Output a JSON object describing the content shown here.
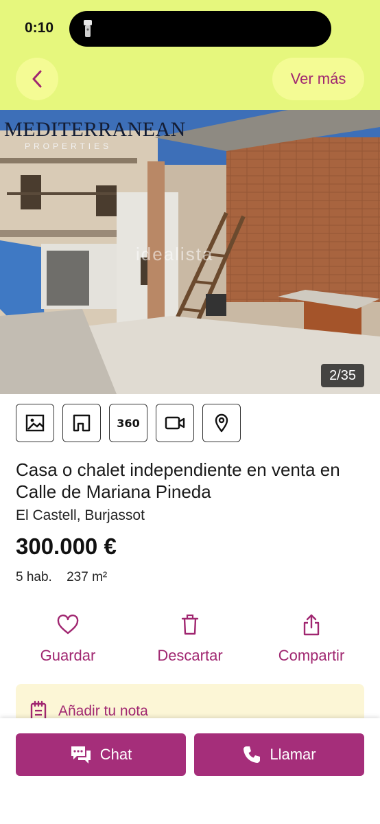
{
  "status_bar": {
    "time": "0:10"
  },
  "header": {
    "more_label": "Ver más"
  },
  "gallery": {
    "brand": "MEDITERRANEAN",
    "brand_sub": "PROPERTIES",
    "watermark": "idealista",
    "counter": "2/35"
  },
  "media_buttons": [
    {
      "icon": "image-icon"
    },
    {
      "icon": "floorplan-icon"
    },
    {
      "icon": "360-icon",
      "label": "360"
    },
    {
      "icon": "video-icon"
    },
    {
      "icon": "map-pin-icon"
    }
  ],
  "listing": {
    "title": "Casa o chalet independiente en venta en Calle de Mariana Pineda",
    "location": "El Castell, Burjassot",
    "price": "300.000 €",
    "rooms": "5 hab.",
    "area": "237 m²"
  },
  "actions": {
    "save_label": "Guardar",
    "discard_label": "Descartar",
    "share_label": "Compartir"
  },
  "note": {
    "label": "Añadir tu nota"
  },
  "footer": {
    "chat_label": "Chat",
    "call_label": "Llamar"
  },
  "colors": {
    "accent": "#a52e7a",
    "header_bg": "#e6f77d",
    "note_bg": "#fcf6d6"
  }
}
